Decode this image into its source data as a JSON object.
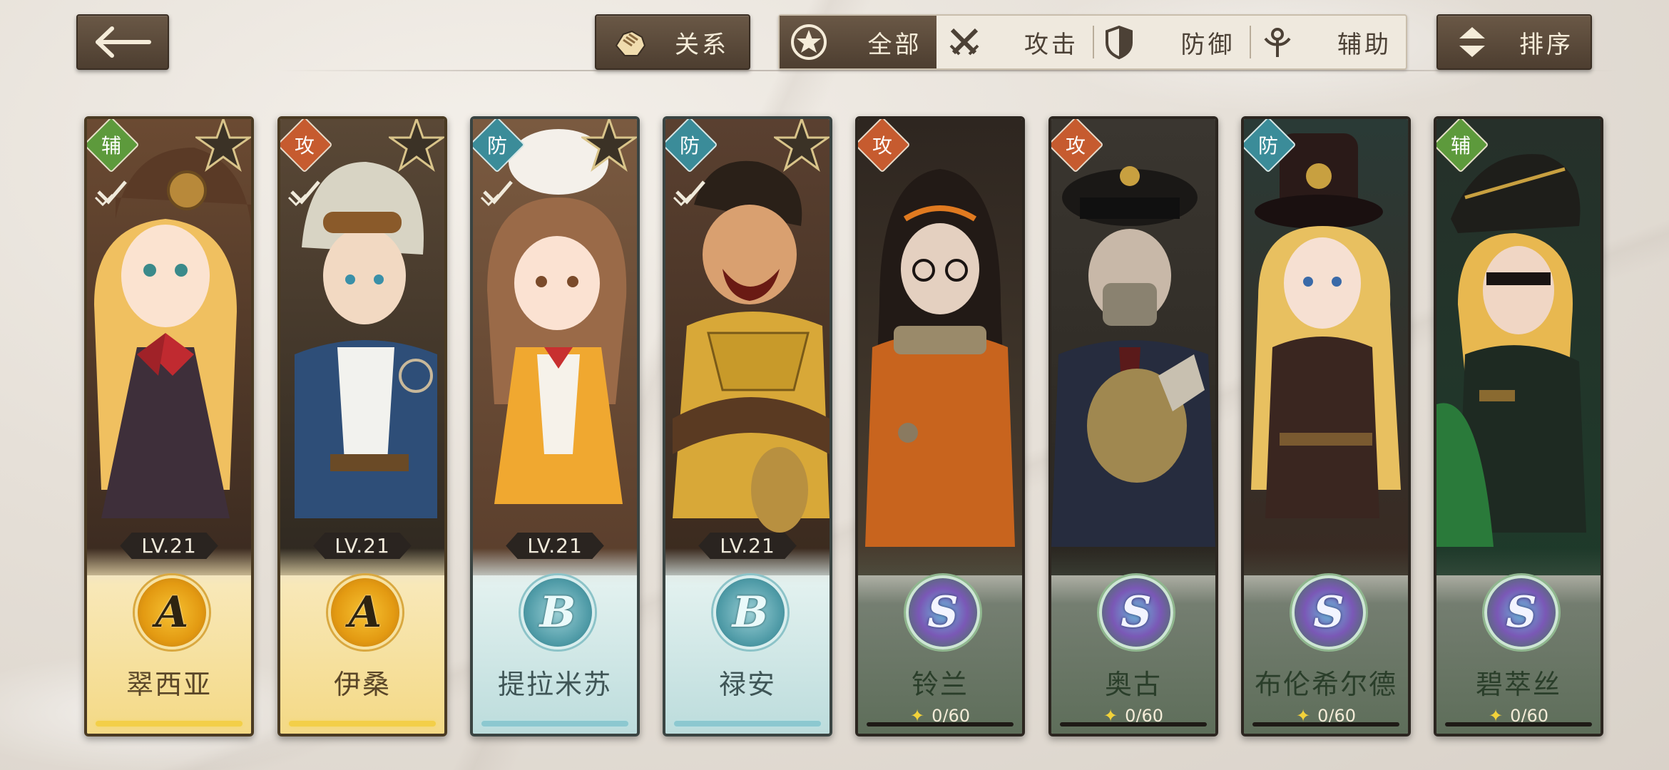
{
  "header": {
    "relation_label": "关系",
    "sort_label": "排序",
    "filters": [
      {
        "label": "全部",
        "icon": "star-emblem-icon",
        "active": true
      },
      {
        "label": "攻击",
        "icon": "crossed-swords-icon",
        "active": false
      },
      {
        "label": "防御",
        "icon": "shield-icon",
        "active": false
      },
      {
        "label": "辅助",
        "icon": "support-staff-icon",
        "active": false
      }
    ]
  },
  "colors": {
    "button_dark": "#5a4a3a",
    "tab_light": "#efe9de",
    "role_support": "#5d9a3c",
    "role_attack": "#c65b2f",
    "role_defense": "#3b8c99"
  },
  "cards": [
    {
      "role": "辅",
      "level": "LV.21",
      "rank": "A",
      "name": "翠西亚",
      "owned": true
    },
    {
      "role": "攻",
      "level": "LV.21",
      "rank": "A",
      "name": "伊桑",
      "owned": true
    },
    {
      "role": "防",
      "level": "LV.21",
      "rank": "B",
      "name": "提拉米苏",
      "owned": true
    },
    {
      "role": "防",
      "level": "LV.21",
      "rank": "B",
      "name": "禄安",
      "owned": true
    },
    {
      "role": "攻",
      "rank": "S",
      "name": "铃兰",
      "shards": "0/60",
      "owned": false
    },
    {
      "role": "攻",
      "rank": "S",
      "name": "奥古",
      "shards": "0/60",
      "owned": false
    },
    {
      "role": "防",
      "rank": "S",
      "name": "布伦希尔德",
      "shards": "0/60",
      "owned": false
    },
    {
      "role": "辅",
      "rank": "S",
      "name": "碧萃丝",
      "shards": "0/60",
      "owned": false
    }
  ]
}
